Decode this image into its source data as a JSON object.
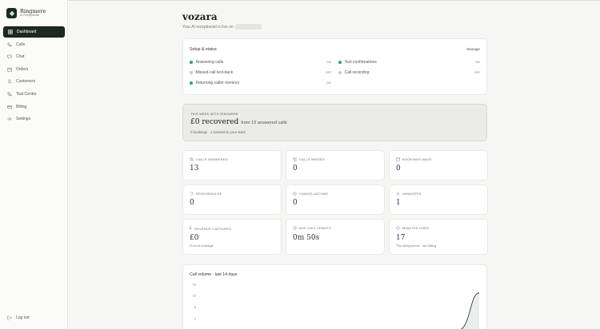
{
  "brand": {
    "name": "Ringmere",
    "subtitle": "AI Receptionist"
  },
  "nav": [
    {
      "id": "dashboard",
      "label": "Dashboard",
      "icon": "grid-icon",
      "active": true
    },
    {
      "id": "calls",
      "label": "Calls",
      "icon": "phone-icon"
    },
    {
      "id": "chat",
      "label": "Chat",
      "icon": "chat-icon"
    },
    {
      "id": "orders",
      "label": "Orders",
      "icon": "calendar-icon"
    },
    {
      "id": "customers",
      "label": "Customers",
      "icon": "user-icon"
    },
    {
      "id": "test-centre",
      "label": "Test Centre",
      "icon": "phone-test-icon"
    },
    {
      "id": "billing",
      "label": "Billing",
      "icon": "card-icon"
    },
    {
      "id": "settings",
      "label": "Settings",
      "icon": "gear-icon"
    }
  ],
  "logout_label": "Log out",
  "page": {
    "title": "vozara",
    "subtitle": "Your AI receptionist is live on"
  },
  "setup": {
    "title": "Setup & status",
    "manage": "Manage",
    "items": [
      {
        "label": "Answering calls",
        "state": "ON"
      },
      {
        "label": "Text confirmations",
        "state": "ON"
      },
      {
        "label": "Missed-call text-back",
        "state": "OFF"
      },
      {
        "label": "Call recording",
        "state": "OFF"
      },
      {
        "label": "Returning-caller memory",
        "state": "ON"
      }
    ]
  },
  "week": {
    "label": "THIS WEEK WITH RINGMERE",
    "amount": "£0 recovered",
    "detail": "from 13 answered calls",
    "foot": "0 bookings · 1 handed to your team"
  },
  "stats": [
    {
      "label": "CALLS ANSWERED",
      "value": "13",
      "icon": "phone-incoming-icon"
    },
    {
      "label": "CALLS MISSED",
      "value": "0",
      "icon": "phone-missed-icon"
    },
    {
      "label": "BOOKINGS MADE",
      "value": "0",
      "icon": "calendar-icon"
    },
    {
      "label": "RESCHEDULES",
      "value": "0",
      "icon": "refresh-icon"
    },
    {
      "label": "CANCELLATIONS",
      "value": "0",
      "icon": "cancel-icon"
    },
    {
      "label": "HANDOFFS",
      "value": "1",
      "icon": "user-icon"
    },
    {
      "label": "REVENUE CAPTURED",
      "value": "£0",
      "foot": "From AI bookings",
      "icon": "pound-icon"
    },
    {
      "label": "AVG CALL LENGTH",
      "value": "0m 50s",
      "icon": "clock-icon"
    },
    {
      "label": "MINUTES USED",
      "value": "17",
      "foot": "This billing period · see Billing",
      "icon": "gauge-icon"
    }
  ],
  "chart": {
    "title": "Call volume · last 14 days",
    "yticks": [
      "16",
      "12",
      "8",
      "4"
    ]
  },
  "chart_data": {
    "type": "area",
    "ylim": [
      0,
      16
    ],
    "x": [
      1,
      2,
      3,
      4,
      5,
      6,
      7,
      8,
      9,
      10,
      11,
      12,
      13,
      14
    ],
    "values": [
      0,
      0,
      0,
      0,
      0,
      0,
      0,
      0,
      0,
      0,
      0,
      0,
      0,
      13
    ],
    "colors": {
      "line": "#1d2a24",
      "fill": "#e3e6e4"
    }
  }
}
